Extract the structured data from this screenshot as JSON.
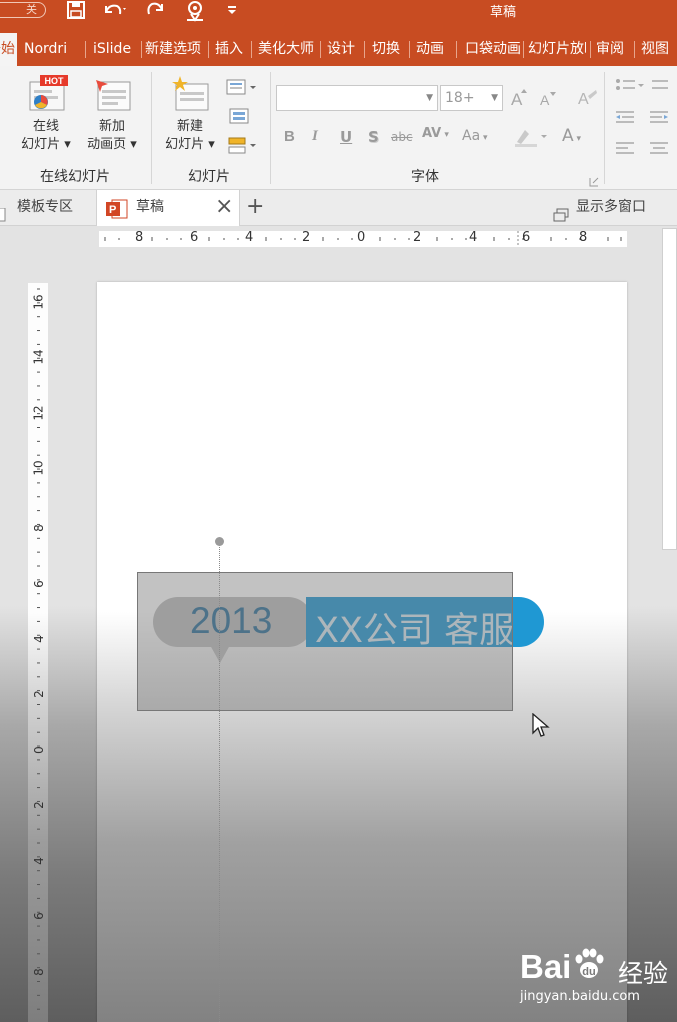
{
  "window": {
    "title": "草稿",
    "autosave_label": "关",
    "qat": {
      "save_icon": "save-icon",
      "undo_icon": "undo-icon",
      "redo_icon": "redo-icon",
      "present_icon": "present-from-start-icon",
      "customize_icon": "chevron-down-icon"
    }
  },
  "tabs": [
    {
      "label": "开始",
      "active": true
    },
    {
      "label": "Nordri"
    },
    {
      "label": "iSlide"
    },
    {
      "label": "新建选项"
    },
    {
      "label": "插入"
    },
    {
      "label": "美化大师"
    },
    {
      "label": "设计"
    },
    {
      "label": "切换"
    },
    {
      "label": "动画"
    },
    {
      "label": "口袋动画"
    },
    {
      "label": "幻灯片放映"
    },
    {
      "label": "审阅"
    },
    {
      "label": "视图"
    }
  ],
  "ribbon": {
    "groups": [
      {
        "label": "在线幻灯片",
        "buttons": [
          {
            "line1": "在线",
            "line2": "幻灯片 ▾",
            "badge": "HOT"
          },
          {
            "line1": "新加",
            "line2": "动画页 ▾"
          }
        ]
      },
      {
        "label": "幻灯片",
        "buttons": [
          {
            "line1": "新建",
            "line2": "幻灯片 ▾"
          }
        ]
      },
      {
        "label": "字体"
      }
    ],
    "font": {
      "name_value": "",
      "size_value": "18+"
    },
    "format_buttons": [
      "B",
      "I",
      "U",
      "S",
      "abc",
      "AV",
      "Aa",
      "A"
    ]
  },
  "doc_tabs": [
    {
      "label": "模板专区"
    },
    {
      "label": "草稿",
      "active": true
    }
  ],
  "doc_tab_actions": {
    "close": "×",
    "new": "+",
    "multiwindow": "显示多窗口"
  },
  "ruler": {
    "horizontal": [
      "8",
      "6",
      "4",
      "2",
      "0",
      "2",
      "4",
      "6",
      "8"
    ],
    "vertical": [
      "16",
      "14",
      "12",
      "10",
      "8",
      "6",
      "4",
      "2",
      "0",
      "2",
      "4",
      "6",
      "8"
    ]
  },
  "slide": {
    "year": "2013",
    "company": "XX公司 客服",
    "colors": {
      "accent": "#1f98d3",
      "year_text": "#2a6e98",
      "pill_gray": "#bdbdbd"
    }
  },
  "watermark": {
    "logo": "Bai",
    "logo_tail": "经验",
    "url": "jingyan.baidu.com"
  },
  "colors": {
    "title_bar": "#c84c22"
  }
}
